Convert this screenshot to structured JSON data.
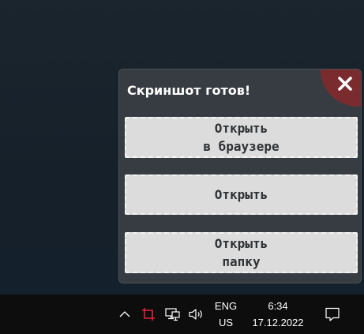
{
  "popup": {
    "title": "Скриншот готов!",
    "close_icon": "close-icon",
    "buttons": [
      {
        "label": "Открыть\nв браузере"
      },
      {
        "label": "Открыть"
      },
      {
        "label": "Открыть\nпапку"
      }
    ]
  },
  "taskbar": {
    "icons": [
      "chevron-up-icon",
      "snip-tool-icon",
      "network-icon",
      "volume-icon",
      "notification-icon"
    ],
    "language": {
      "line1": "ENG",
      "line2": "US"
    },
    "clock": {
      "time": "6:34",
      "date": "17.12.2022"
    }
  },
  "colors": {
    "popup_background": "#373c42",
    "close_corner": "#7a2b2e",
    "button_background": "#dcdcdc",
    "taskbar_background": "#0d0d0d",
    "snip_icon": "#e0243d"
  }
}
